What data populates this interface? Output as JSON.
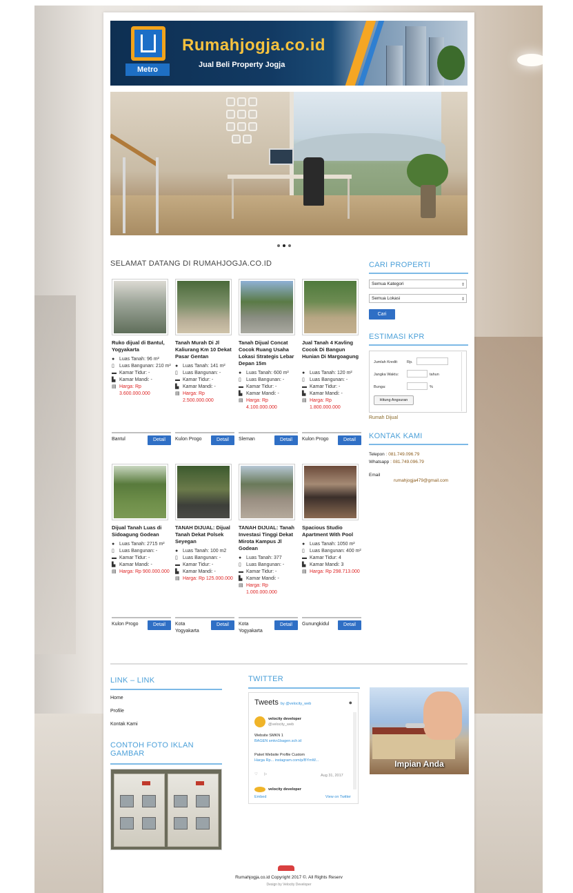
{
  "banner": {
    "site_name": "Rumahjogja.co.id",
    "tagline": "Jual Beli Property Jogja",
    "logo_sub": "Metro"
  },
  "slider": {
    "dots": 3,
    "active": 1
  },
  "welcome": {
    "title": "SELAMAT DATANG DI RUMAHJOGJA.CO.ID"
  },
  "listings": [
    {
      "title": "Ruko dijual di Bantul, Yogyakarta",
      "luas_tanah": "Luas Tanah: 96 m²",
      "luas_bangunan": "Luas Bangunan: 210 m²",
      "kamar_tidur": "Kamar Tidur: -",
      "kamar_mandi": "Kamar Mandi: -",
      "harga": "Harga: Rp 3.600.000.000",
      "lokasi": "Bantul",
      "detail": "Detail"
    },
    {
      "title": "Tanah Murah Di Jl Kaliurang Km 10 Dekat Pasar Gentan",
      "luas_tanah": "Luas Tanah: 141 m²",
      "luas_bangunan": "Luas Bangunan: -",
      "kamar_tidur": "Kamar Tidur: -",
      "kamar_mandi": "Kamar Mandi: -",
      "harga": "Harga: Rp 2.500.000.000",
      "lokasi": "Kulon Progo",
      "detail": "Detail"
    },
    {
      "title": "Tanah Dijual Concat Cocok Ruang Usaha Lokasi Strategis Lebar Depan 15m",
      "luas_tanah": "Luas Tanah: 600 m²",
      "luas_bangunan": "Luas Bangunan: -",
      "kamar_tidur": "Kamar Tidur: -",
      "kamar_mandi": "Kamar Mandi: -",
      "harga": "Harga: Rp 4.100.000.000",
      "lokasi": "Sleman",
      "detail": "Detail"
    },
    {
      "title": "Jual Tanah 4 Kavling Cocok Di Bangun Hunian Di Margoagung",
      "luas_tanah": "Luas Tanah: 120 m²",
      "luas_bangunan": "Luas Bangunan: -",
      "kamar_tidur": "Kamar Tidur: -",
      "kamar_mandi": "Kamar Mandi: -",
      "harga": "Harga: Rp 1.800.000.000",
      "lokasi": "Kulon Progo",
      "detail": "Detail"
    },
    {
      "title": "Dijual Tanah Luas di Sidoagung Godean",
      "luas_tanah": "Luas Tanah: 2715 m²",
      "luas_bangunan": "Luas Bangunan: -",
      "kamar_tidur": "Kamar Tidur: -",
      "kamar_mandi": "Kamar Mandi: -",
      "harga": "Harga: Rp 900.000.000",
      "lokasi": "Kulon Progo",
      "detail": "Detail"
    },
    {
      "title": "TANAH DIJUAL: Dijual Tanah Dekat Polsek Seyegan",
      "luas_tanah": "Luas Tanah: 100 m2",
      "luas_bangunan": "Luas Bangunan: -",
      "kamar_tidur": "Kamar Tidur: -",
      "kamar_mandi": "Kamar Mandi: -",
      "harga": "Harga: Rp 125.000.000",
      "lokasi": "Kota Yogyakarta",
      "detail": "Detail"
    },
    {
      "title": "TANAH DIJUAL: Tanah Investasi Tinggi Dekat Mirota Kampus Jl Godean",
      "luas_tanah": "Luas Tanah: 377",
      "luas_bangunan": "Luas Bangunan: -",
      "kamar_tidur": "Kamar Tidur: -",
      "kamar_mandi": "Kamar Mandi: -",
      "harga": "Harga: Rp 1.000.000.000",
      "lokasi": "Kota Yogyakarta",
      "detail": "Detail"
    },
    {
      "title": "Spacious Studio Apartment With Pool",
      "luas_tanah": "Luas Tanah: 1050 m²",
      "luas_bangunan": "Luas Bangunan: 400 m²",
      "kamar_tidur": "Kamar Tidur: 4",
      "kamar_mandi": "Kamar Mandi: 3",
      "harga": "Harga: Rp 298.713.000",
      "lokasi": "Gunungkidul",
      "detail": "Detail"
    }
  ],
  "sidebar": {
    "cari_title": "CARI PROPERTI",
    "kategori": "Semua Kategori",
    "lokasi": "Semua Lokasi",
    "cari_btn": "Cari",
    "kpr_title": "ESTIMASI KPR",
    "kpr": {
      "jumlah_label": "Jumlah Kredit:",
      "jumlah_unit": "Rp.",
      "jangka_label": "Jangka Waktu:",
      "jangka_unit": "tahun",
      "bunga_label": "Bunga:",
      "bunga_unit": "%",
      "hitung": "Hitung Angsuran"
    },
    "rumah_dijual": "Rumah Dijual",
    "kontak_title": "KONTAK KAMI",
    "telepon_label": "Telepon",
    "telepon": ": 081.749.096.79",
    "whatsapp_label": "Whatsapp",
    "whatsapp": ": 081.749.096.79",
    "email_label": "Email",
    "email": "rumahjogja479@gmail.com"
  },
  "footer": {
    "links_title": "LINK – LINK",
    "links": [
      "Home",
      "Profile",
      "Kontak Kami"
    ],
    "contoh_title": "CONTOH FOTO IKLAN GAMBAR",
    "twitter_title": "TWITTER",
    "tweets_label": "Tweets",
    "tweets_by": "by @velocity_web",
    "tweet1_name": "velocity developer",
    "tweet1_handle": "@velocity_web",
    "tweet1_line1": "Website SMKN 1",
    "tweet1_line2": "BAGEN smkn1bagen.sch.id",
    "tweet1_line3": "Paket Website Profile Custom",
    "tweet1_line4": "Harga Rp... instagram.com/p/BYmW...",
    "tweet1_date": "Aug 31, 2017",
    "tweet2_name": "velocity developer",
    "embed": "Embed",
    "view": "View on Twitter",
    "impian": "Impian Anda",
    "copyright": "Rumahjogja.co.id Copyright 2017 ©. All Rights Reserv",
    "copyright_sub": "Design by Velocity Developer"
  }
}
